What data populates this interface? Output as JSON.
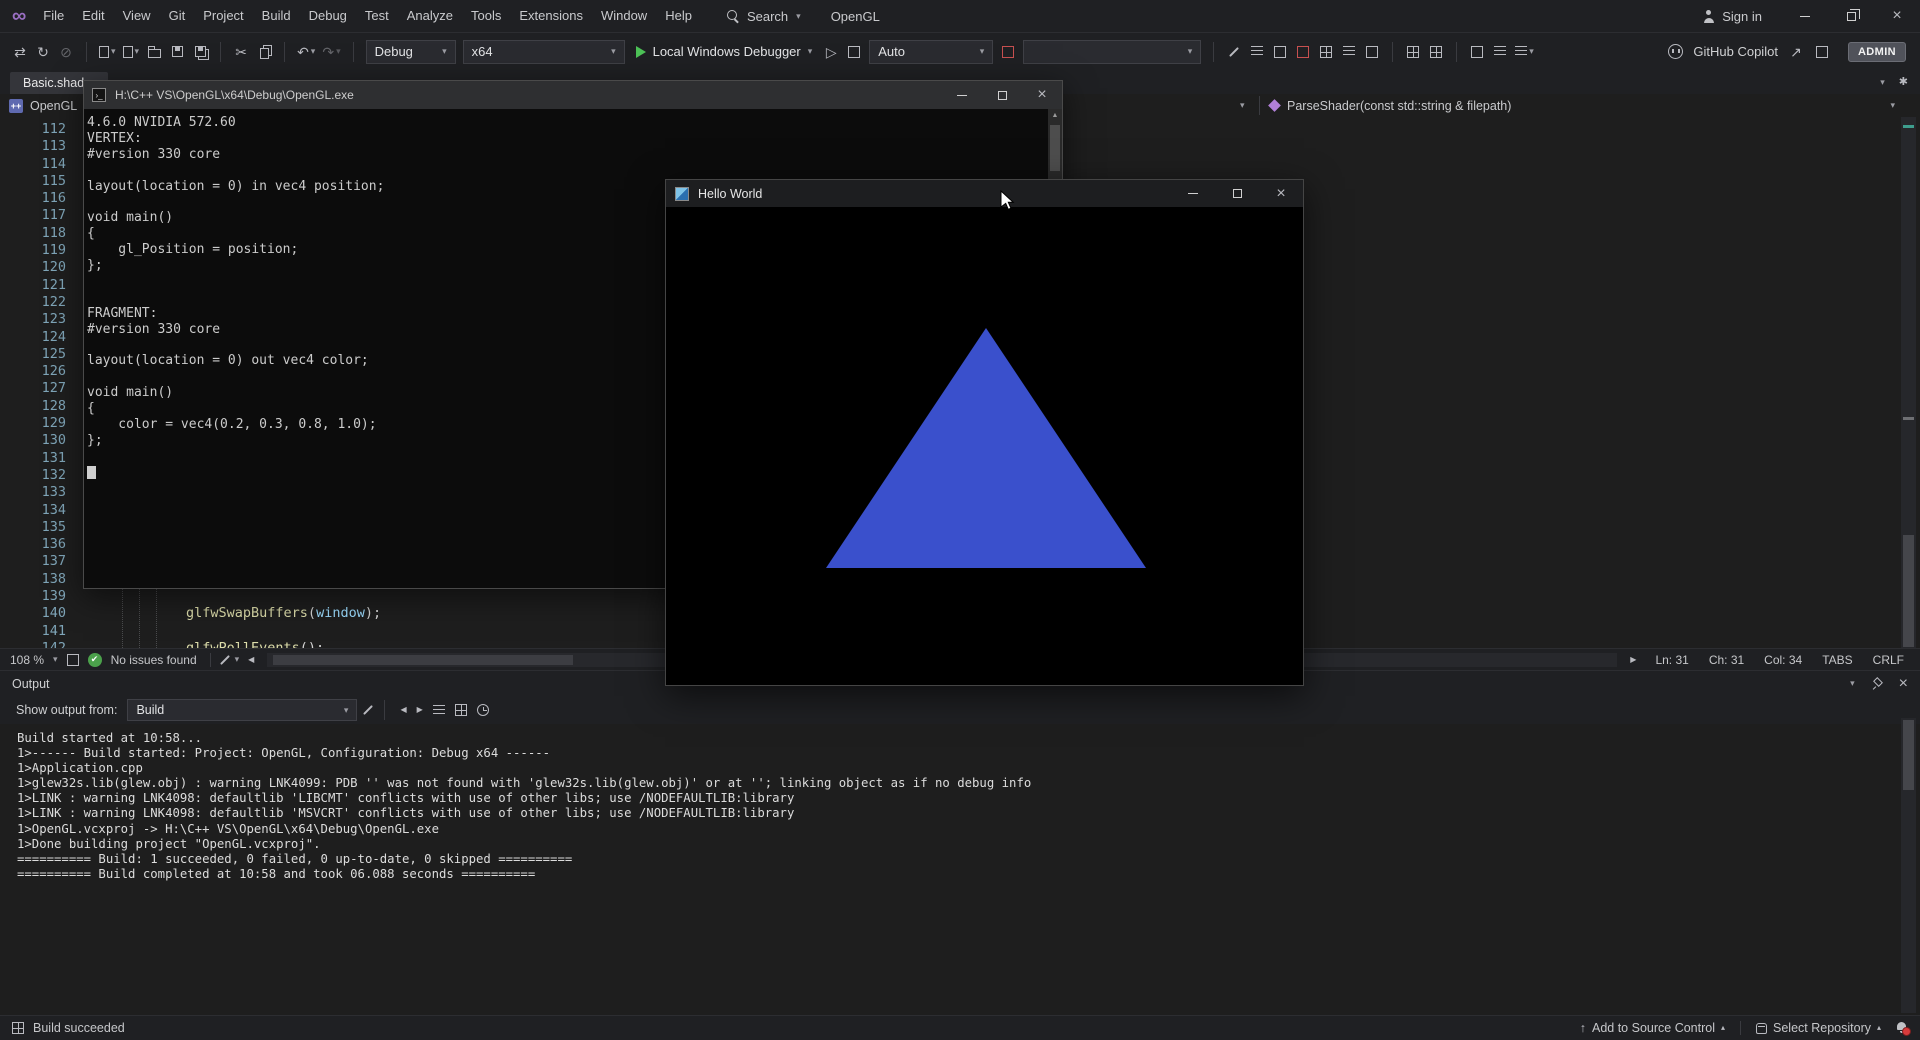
{
  "titlebar": {
    "menus": [
      "File",
      "Edit",
      "View",
      "Git",
      "Project",
      "Build",
      "Debug",
      "Test",
      "Analyze",
      "Tools",
      "Extensions",
      "Window",
      "Help"
    ],
    "search_label": "Search",
    "solution_name": "OpenGL",
    "sign_in_label": "Sign in"
  },
  "toolbar": {
    "configuration": "Debug",
    "platform": "x64",
    "debug_target": "Local Windows Debugger",
    "watch_mode": "Auto",
    "copilot_label": "GitHub Copilot",
    "admin_label": "ADMIN"
  },
  "editor": {
    "tab_label": "Basic.shader",
    "nav_project": "OpenGL",
    "nav_member": "ParseShader(const std::string & filepath)",
    "first_line_number": 112,
    "last_line_number": 142,
    "code_lines": [
      {
        "line": 140,
        "segments": [
          {
            "text": "glfwSwapBuffers",
            "style": "fn"
          },
          {
            "text": "(",
            "style": "pl"
          },
          {
            "text": "window",
            "style": "id"
          },
          {
            "text": ");",
            "style": "pl"
          }
        ]
      },
      {
        "line": 142,
        "segments": [
          {
            "text": "glfwPollEvents",
            "style": "fn"
          },
          {
            "text": "();",
            "style": "pl"
          }
        ]
      }
    ],
    "status": {
      "zoom": "108 %",
      "health": "No issues found",
      "line": "Ln: 31",
      "character": "Ch: 31",
      "column": "Col: 34",
      "tabs_indicator": "TABS",
      "line_ending": "CRLF"
    }
  },
  "console_window": {
    "title": "H:\\C++ VS\\OpenGL\\x64\\Debug\\OpenGL.exe",
    "lines": [
      "4.6.0 NVIDIA 572.60",
      "VERTEX:",
      "#version 330 core",
      "",
      "layout(location = 0) in vec4 position;",
      "",
      "void main()",
      "{",
      "    gl_Position = position;",
      "};",
      "",
      "",
      "FRAGMENT:",
      "#version 330 core",
      "",
      "layout(location = 0) out vec4 color;",
      "",
      "void main()",
      "{",
      "    color = vec4(0.2, 0.3, 0.8, 1.0);",
      "};",
      ""
    ]
  },
  "hello_window": {
    "title": "Hello World",
    "triangle_color": "#3a50cc"
  },
  "output_panel": {
    "title": "Output",
    "show_output_from_label": "Show output from:",
    "selected_source": "Build",
    "lines": [
      "Build started at 10:58...",
      "1>------ Build started: Project: OpenGL, Configuration: Debug x64 ------",
      "1>Application.cpp",
      "1>glew32s.lib(glew.obj) : warning LNK4099: PDB '' was not found with 'glew32s.lib(glew.obj)' or at ''; linking object as if no debug info",
      "1>LINK : warning LNK4098: defaultlib 'LIBCMT' conflicts with use of other libs; use /NODEFAULTLIB:library",
      "1>LINK : warning LNK4098: defaultlib 'MSVCRT' conflicts with use of other libs; use /NODEFAULTLIB:library",
      "1>OpenGL.vcxproj -> H:\\C++ VS\\OpenGL\\x64\\Debug\\OpenGL.exe",
      "1>Done building project \"OpenGL.vcxproj\".",
      "========== Build: 1 succeeded, 0 failed, 0 up-to-date, 0 skipped ==========",
      "========== Build completed at 10:58 and took 06.088 seconds =========="
    ]
  },
  "statusbar": {
    "build_status": "Build succeeded",
    "add_to_source_control": "Add to Source Control",
    "select_repository": "Select Repository"
  }
}
